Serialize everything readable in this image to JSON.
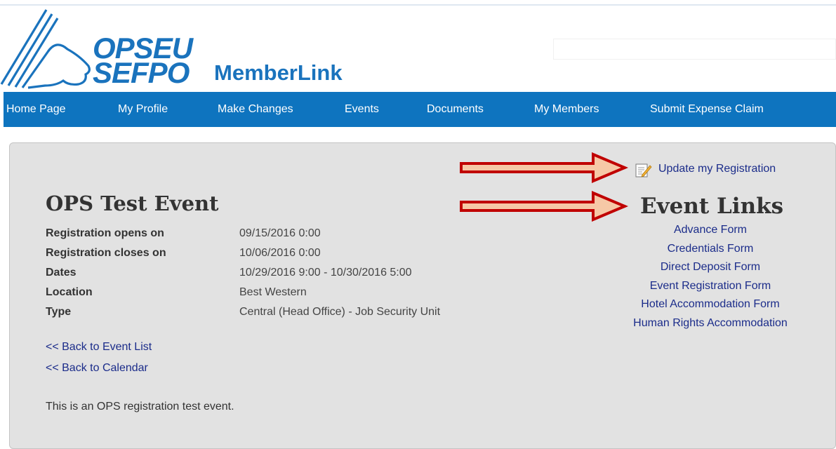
{
  "header": {
    "logo_line1": "OPSEU",
    "logo_line2": "SEFPO",
    "app_title": "MemberLink",
    "brand_color": "#1a73bd"
  },
  "nav": {
    "items": [
      {
        "label": "Home Page"
      },
      {
        "label": "My Profile"
      },
      {
        "label": "Make Changes"
      },
      {
        "label": "Events"
      },
      {
        "label": "Documents"
      },
      {
        "label": "My Members"
      },
      {
        "label": "Submit Expense Claim"
      }
    ],
    "background": "#0e74bf"
  },
  "event": {
    "title": "OPS Test Event",
    "details": [
      {
        "label": "Registration opens on",
        "value": "09/15/2016 0:00"
      },
      {
        "label": "Registration closes on",
        "value": "10/06/2016 0:00"
      },
      {
        "label": "Dates",
        "value": "10/29/2016 9:00 - 10/30/2016 5:00"
      },
      {
        "label": "Location",
        "value": "Best Western"
      },
      {
        "label": "Type",
        "value": "Central (Head Office) - Job Security Unit"
      }
    ],
    "back_links": [
      {
        "label": "<< Back to Event List"
      },
      {
        "label": "<< Back to Calendar"
      }
    ],
    "description": "This is an OPS registration test event."
  },
  "sidebar": {
    "update_icon": "edit-note-icon",
    "update_label": "Update my Registration",
    "links_title": "Event Links",
    "links": [
      {
        "label": "Advance Form"
      },
      {
        "label": "Credentials Form"
      },
      {
        "label": "Direct Deposit Form"
      },
      {
        "label": "Event Registration Form"
      },
      {
        "label": "Hotel Accommodation Form"
      },
      {
        "label": "Human Rights Accommodation"
      }
    ]
  },
  "annotations": {
    "arrow_color": "#c00000",
    "arrow_fill": "#f6c8a6"
  }
}
